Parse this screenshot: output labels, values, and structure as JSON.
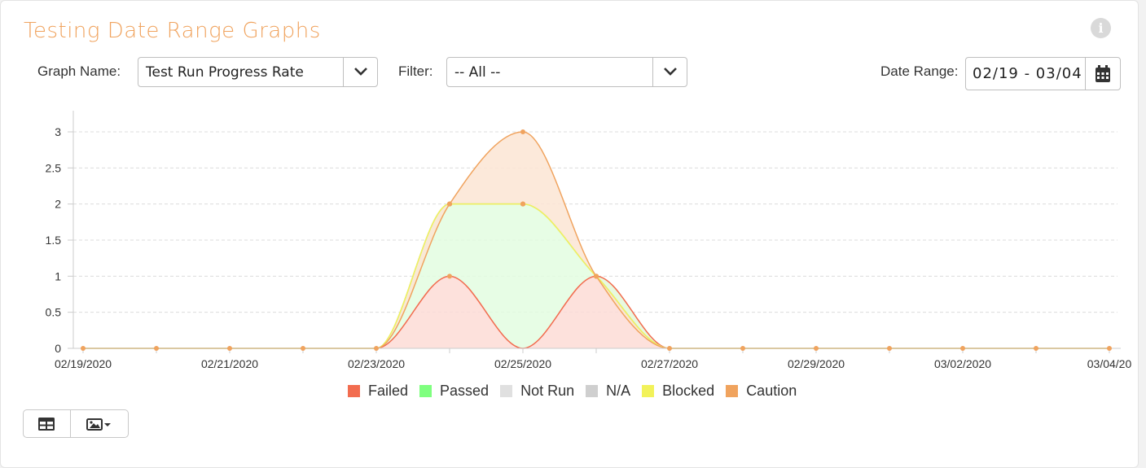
{
  "header": {
    "title": "Testing Date Range Graphs",
    "info_icon": "info-circle-icon"
  },
  "controls": {
    "graph_name_label": "Graph Name:",
    "graph_name_value": "Test Run Progress Rate",
    "filter_label": "Filter:",
    "filter_value": "-- All --",
    "date_range_label": "Date Range:",
    "date_range_value": "02/19 - 03/04"
  },
  "chart_data": {
    "type": "area",
    "x": [
      "02/19/2020",
      "02/20/2020",
      "02/21/2020",
      "02/22/2020",
      "02/23/2020",
      "02/24/2020",
      "02/25/2020",
      "02/26/2020",
      "02/27/2020",
      "02/28/2020",
      "02/29/2020",
      "03/01/2020",
      "03/02/2020",
      "03/03/2020",
      "03/04/2020"
    ],
    "x_tick_labels": [
      "02/19/2020",
      "02/21/2020",
      "02/23/2020",
      "02/25/2020",
      "02/27/2020",
      "02/29/2020",
      "03/02/2020",
      "03/04/20"
    ],
    "y_ticks": [
      "0",
      "0.5",
      "1",
      "1.5",
      "2",
      "2.5",
      "3"
    ],
    "ylim": [
      0,
      3.25
    ],
    "stacked": true,
    "grid": "horizontal dashed",
    "legend_position": "bottom",
    "series": [
      {
        "name": "Failed",
        "color": "#f26c4f",
        "fill": "#fddcd6",
        "values": [
          0,
          0,
          0,
          0,
          0,
          1,
          0,
          1,
          0,
          0,
          0,
          0,
          0,
          0,
          0
        ]
      },
      {
        "name": "Passed",
        "color": "#7fff7f",
        "fill": "#e3fde0",
        "values": [
          0,
          0,
          0,
          0,
          0,
          1,
          2,
          0,
          0,
          0,
          0,
          0,
          0,
          0,
          0
        ]
      },
      {
        "name": "Not Run",
        "color": "#e0e0e0",
        "fill": "#eeeeee",
        "values": [
          0,
          0,
          0,
          0,
          0,
          0,
          0,
          0,
          0,
          0,
          0,
          0,
          0,
          0,
          0
        ]
      },
      {
        "name": "N/A",
        "color": "#cfcfcf",
        "fill": "#e6e6e6",
        "values": [
          0,
          0,
          0,
          0,
          0,
          0,
          0,
          0,
          0,
          0,
          0,
          0,
          0,
          0,
          0
        ]
      },
      {
        "name": "Blocked",
        "color": "#f2f25a",
        "fill": "#f7f7c6",
        "values": [
          0,
          0,
          0,
          0,
          0,
          0,
          0,
          0,
          0,
          0,
          0,
          0,
          0,
          0,
          0
        ]
      },
      {
        "name": "Caution",
        "color": "#f0a35e",
        "fill": "#fbe5d3",
        "values": [
          0,
          0,
          0,
          0,
          0,
          0,
          1,
          0,
          0,
          0,
          0,
          0,
          0,
          0,
          0
        ]
      }
    ]
  },
  "toolbar": {
    "table_icon": "table-icon",
    "image_icon": "image-dropdown-icon"
  }
}
